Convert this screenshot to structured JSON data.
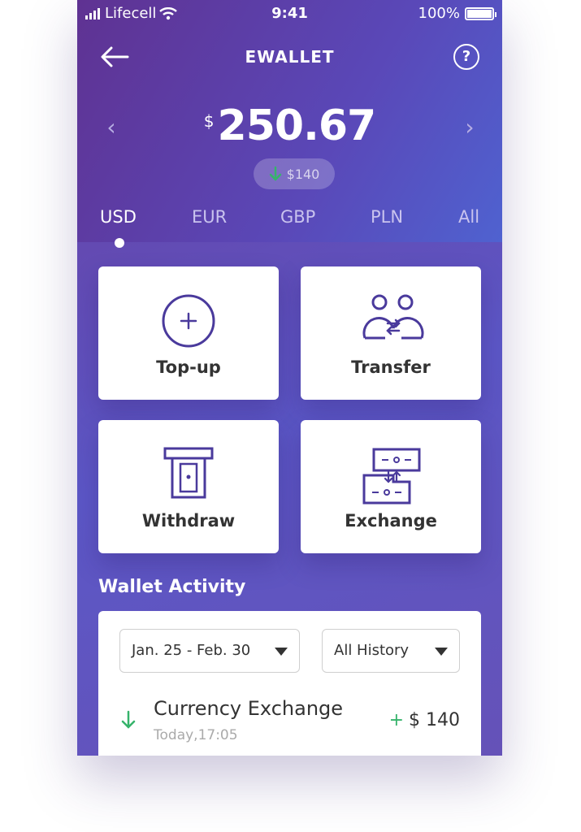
{
  "status_bar": {
    "carrier": "Lifecell",
    "time": "9:41",
    "battery": "100%"
  },
  "header": {
    "title": "EWALLET",
    "help_label": "?"
  },
  "balance": {
    "currency_symbol": "$",
    "amount": "250.67",
    "change": "$140"
  },
  "currency_tabs": [
    "USD",
    "EUR",
    "GBP",
    "PLN",
    "All"
  ],
  "actions": {
    "topup": "Top-up",
    "transfer": "Transfer",
    "withdraw": "Withdraw",
    "exchange": "Exchange"
  },
  "activity": {
    "title": "Wallet Activity",
    "date_filter": "Jan. 25 - Feb. 30",
    "history_filter": "All History",
    "transactions": [
      {
        "title": "Currency Exchange",
        "date": "Today,17:05",
        "sign": "+",
        "amount": "$ 140"
      }
    ]
  },
  "colors": {
    "accent_purple": "#5b3ea6",
    "positive_green": "#36b36b"
  },
  "icons": {
    "back": "arrow-left-icon",
    "help": "help-circle-icon",
    "prev": "chevron-left-icon",
    "next": "chevron-right-icon",
    "topup": "plus-circle-icon",
    "transfer": "people-transfer-icon",
    "withdraw": "atm-icon",
    "exchange": "exchange-icon"
  }
}
